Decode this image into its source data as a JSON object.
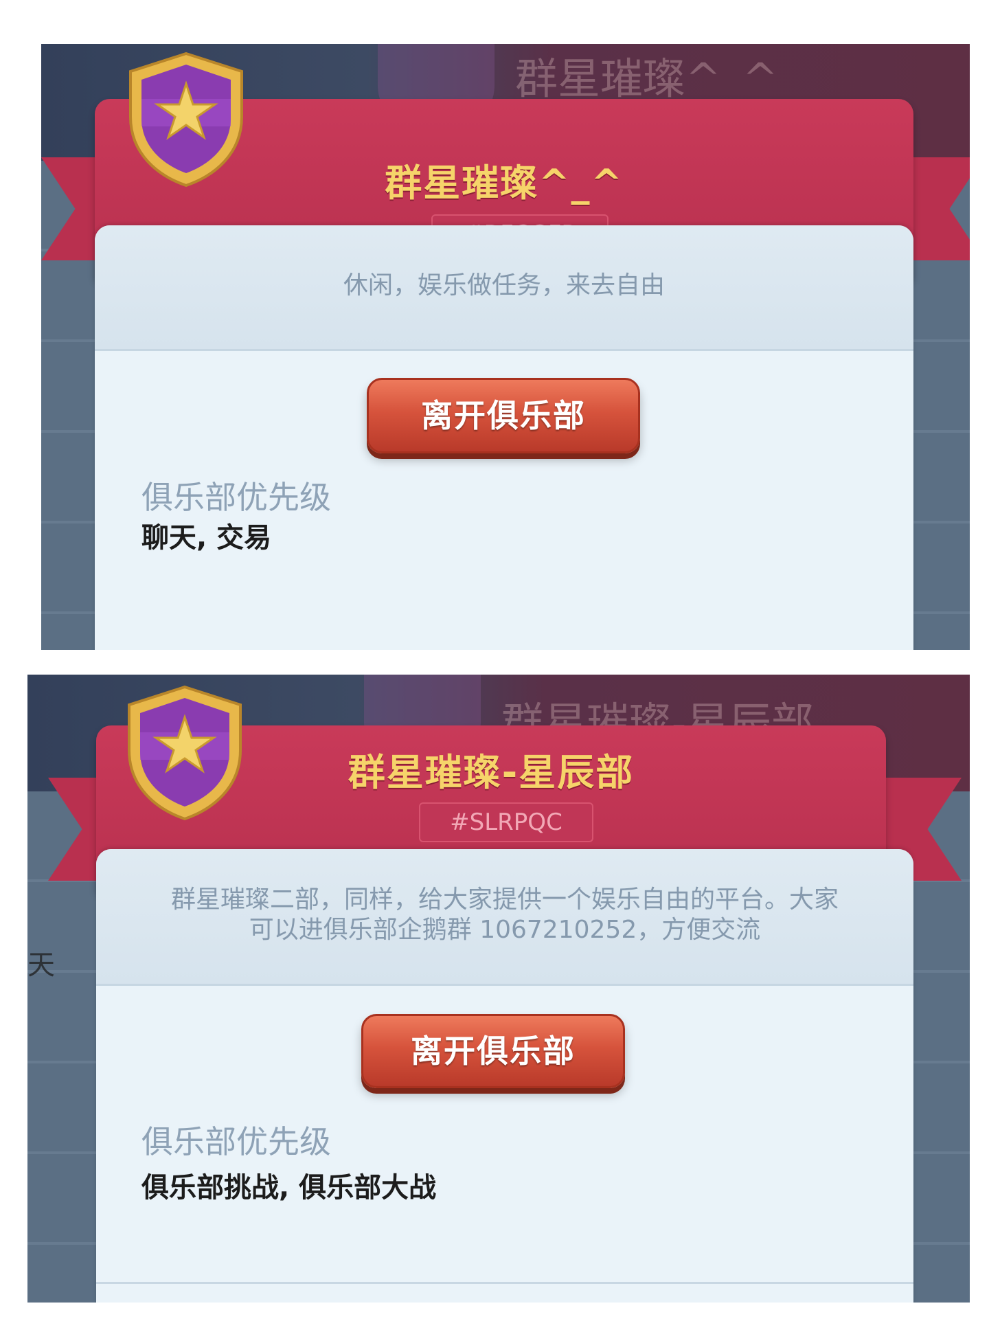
{
  "colors": {
    "ribbon": "#b8304f",
    "title_gold": "#f6d46a",
    "button_red": "#d6533c",
    "card_bg": "#eaf3f9",
    "badge_purple": "#8a3cb0",
    "badge_gold": "#e8b84a"
  },
  "screens": [
    {
      "club_name": "群星璀璨^_^",
      "ghost_name": "群星璀璨^_^",
      "club_tag": "#RFCGFP",
      "description": "休闲，娱乐做任务，来去自由",
      "leave_button": "离开俱乐部",
      "priority_label": "俱乐部优先级",
      "priority_value": "聊天, 交易"
    },
    {
      "club_name": "群星璀璨-星辰部",
      "ghost_name": "群星璀璨-星辰部",
      "club_tag": "#SLRPQC",
      "description_line1": "群星璀璨二部，同样，给大家提供一个娱乐自由的平台。大家",
      "description_line2": "可以进俱乐部企鹅群 1067210252，方便交流",
      "leave_button": "离开俱乐部",
      "priority_label": "俱乐部优先级",
      "priority_value": "俱乐部挑战, 俱乐部大战",
      "side_fragment": "天"
    }
  ],
  "icons": [
    "club-badge-icon",
    "star-icon"
  ]
}
